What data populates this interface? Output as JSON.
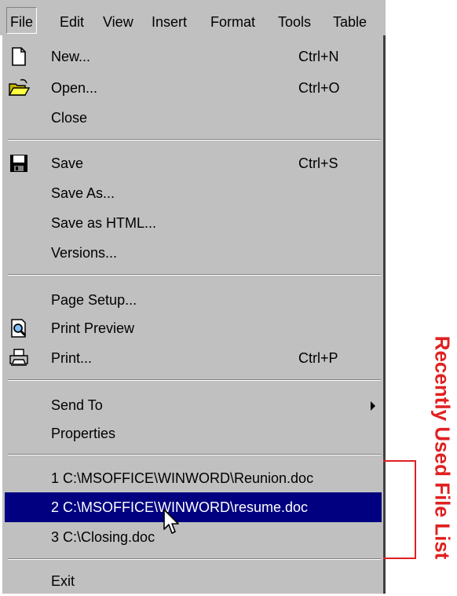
{
  "menubar": [
    {
      "label": "File",
      "selected": true
    },
    {
      "label": "Edit"
    },
    {
      "label": "View"
    },
    {
      "label": "Insert"
    },
    {
      "label": "Format"
    },
    {
      "label": "Tools"
    },
    {
      "label": "Table"
    }
  ],
  "menu": {
    "items": [
      {
        "label": "New...",
        "shortcut": "Ctrl+N",
        "icon": "new-document-icon"
      },
      {
        "label": "Open...",
        "shortcut": "Ctrl+O",
        "icon": "open-folder-icon"
      },
      {
        "label": "Close"
      },
      {
        "label": "Save",
        "shortcut": "Ctrl+S",
        "icon": "save-disk-icon"
      },
      {
        "label": "Save As..."
      },
      {
        "label": "Save as HTML..."
      },
      {
        "label": "Versions..."
      },
      {
        "label": "Page Setup..."
      },
      {
        "label": "Print Preview",
        "icon": "print-preview-icon"
      },
      {
        "label": "Print...",
        "shortcut": "Ctrl+P",
        "icon": "printer-icon"
      },
      {
        "label": "Send To",
        "submenu": true
      },
      {
        "label": "Properties"
      },
      {
        "label": "1 C:\\MSOFFICE\\WINWORD\\Reunion.doc"
      },
      {
        "label": "2 C:\\MSOFFICE\\WINWORD\\resume.doc",
        "highlighted": true
      },
      {
        "label": "3 C:\\Closing.doc"
      },
      {
        "label": "Exit"
      }
    ]
  },
  "annotation": {
    "label": "Recently Used File List",
    "color": "#e02020"
  },
  "colors": {
    "menu_bg": "#c0c0c0",
    "highlight": "#000080"
  }
}
